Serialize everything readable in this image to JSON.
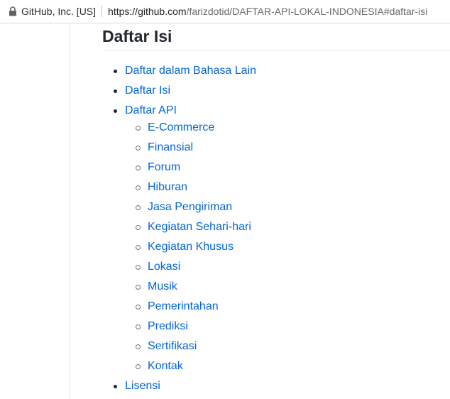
{
  "address_bar": {
    "site_identity": "GitHub, Inc. [US]",
    "url_host": "https://github.com",
    "url_path": "/farizdotid/DAFTAR-API-LOKAL-INDONESIA#daftar-isi"
  },
  "heading": "Daftar Isi",
  "toc": {
    "items": [
      {
        "label": "Daftar dalam Bahasa Lain"
      },
      {
        "label": "Daftar Isi"
      },
      {
        "label": "Daftar API",
        "children": [
          {
            "label": "E-Commerce"
          },
          {
            "label": "Finansial"
          },
          {
            "label": "Forum"
          },
          {
            "label": "Hiburan"
          },
          {
            "label": "Jasa Pengiriman"
          },
          {
            "label": "Kegiatan Sehari-hari"
          },
          {
            "label": "Kegiatan Khusus"
          },
          {
            "label": "Lokasi"
          },
          {
            "label": "Musik"
          },
          {
            "label": "Pemerintahan"
          },
          {
            "label": "Prediksi"
          },
          {
            "label": "Sertifikasi"
          },
          {
            "label": "Kontak"
          }
        ]
      },
      {
        "label": "Lisensi"
      }
    ]
  },
  "colors": {
    "link": "#0366d6",
    "heading": "#24292e",
    "lock": "#5f6368"
  }
}
